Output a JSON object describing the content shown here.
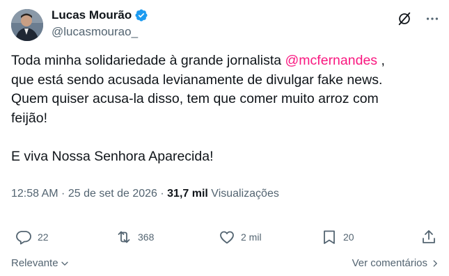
{
  "author": {
    "display_name": "Lucas Mourão",
    "handle": "@lucasmourao_",
    "verified": true,
    "verified_color": "#1d9bf0"
  },
  "tweet": {
    "line1_before": "Toda minha solidariedade à grande jornalista ",
    "mention": "@mcfernandes",
    "line1_after": " ,",
    "line2": "que está sendo acusada levianamente de divulgar fake news.",
    "line3": "Quem quiser acusa-la disso, tem que comer muito arroz com",
    "line4": "feijão!",
    "line5": "E viva Nossa Senhora Aparecida!"
  },
  "meta": {
    "time": "12:58 AM",
    "separator": " · ",
    "date": "25 de set de 2026",
    "views_count": "31,7 mil",
    "views_label": " Visualizações"
  },
  "actions": {
    "replies": "22",
    "retweets": "368",
    "likes": "2 mil",
    "bookmarks": "20"
  },
  "footer": {
    "sort_label": "Relevante",
    "more_replies": "Ver comentários"
  },
  "colors": {
    "mention": "#f91880",
    "secondary_text": "#536471",
    "primary_text": "#0f1419"
  },
  "icons": [
    "verified-badge-icon",
    "grok-icon",
    "more-icon",
    "reply-icon",
    "retweet-icon",
    "like-icon",
    "bookmark-icon",
    "share-icon",
    "chevron-down-icon",
    "chevron-right-icon"
  ]
}
